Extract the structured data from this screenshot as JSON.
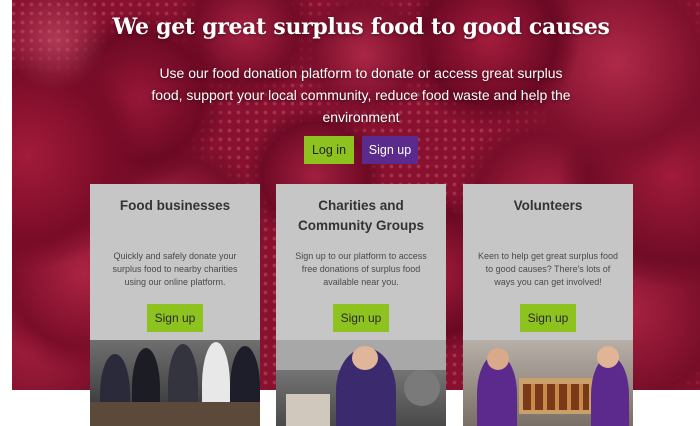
{
  "hero": {
    "title": "We get great surplus food to good causes",
    "subtitle": "Use our food donation platform to donate or access great surplus food, support your local community, reduce food waste and help the environment",
    "login_label": "Log in",
    "signup_label": "Sign up"
  },
  "cards": [
    {
      "title": "Food businesses",
      "text": "Quickly and safely donate your surplus food to nearby charities using our online platform.",
      "button": "Sign up"
    },
    {
      "title": "Charities and Community Groups",
      "text": "Sign up to our platform to access free donations of surplus food available near you.",
      "button": "Sign up"
    },
    {
      "title": "Volunteers",
      "text": "Keen to help get great surplus food to good causes? There's lots of ways you can get involved!",
      "button": "Sign up"
    }
  ],
  "colors": {
    "accent_green": "#8dc21f",
    "accent_purple": "#5a2a8c",
    "card_grey": "#c6c6c6"
  }
}
